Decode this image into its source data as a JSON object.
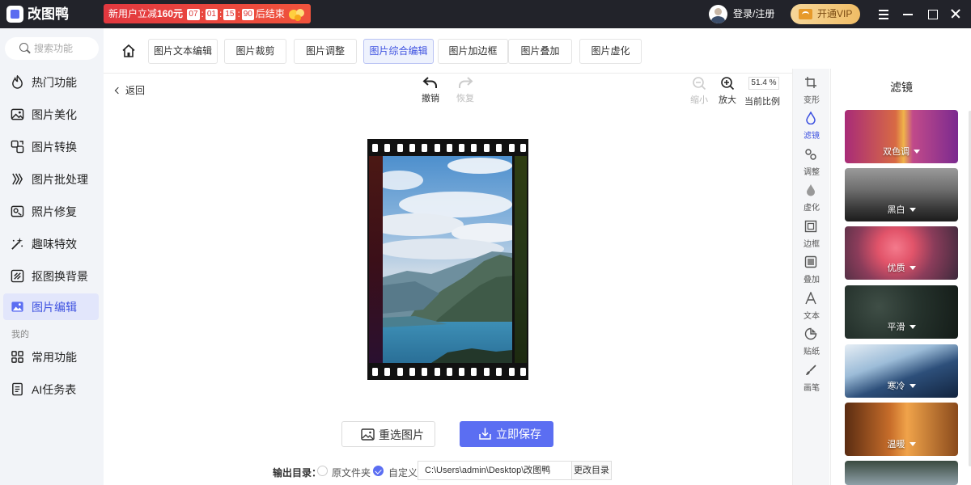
{
  "app": {
    "name": "改图鸭",
    "promo": {
      "prefix": "新用户立减",
      "amount": "160元",
      "countdown": [
        "07",
        "01",
        "15",
        "90"
      ],
      "suffix": "后结束"
    },
    "login": "登录/注册",
    "vip": "开通VIP"
  },
  "sidebar": {
    "search_placeholder": "搜索功能",
    "items": [
      {
        "label": "热门功能",
        "icon": "fire-icon"
      },
      {
        "label": "图片美化",
        "icon": "image-beautify-icon"
      },
      {
        "label": "图片转换",
        "icon": "convert-icon"
      },
      {
        "label": "图片批处理",
        "icon": "batch-icon"
      },
      {
        "label": "照片修复",
        "icon": "repair-icon"
      },
      {
        "label": "趣味特效",
        "icon": "magic-wand-icon"
      },
      {
        "label": "抠图换背景",
        "icon": "cutout-icon"
      },
      {
        "label": "图片编辑",
        "icon": "image-edit-icon",
        "active": true
      }
    ],
    "section_mine": "我的",
    "mine_items": [
      {
        "label": "常用功能",
        "icon": "grid-icon"
      },
      {
        "label": "AI任务表",
        "icon": "document-icon"
      }
    ]
  },
  "tabs": [
    "图片文本编辑",
    "图片裁剪",
    "图片调整",
    "图片综合编辑",
    "图片加边框",
    "图片叠加",
    "图片虚化"
  ],
  "active_tab": "图片综合编辑",
  "toolbar": {
    "back": "返回",
    "undo": "撤销",
    "redo": "恢复",
    "zoom_out": "缩小",
    "zoom_in": "放大",
    "zoom_value": "51.4 %",
    "zoom_label": "当前比例"
  },
  "actions": {
    "reselect": "重选图片",
    "save": "立即保存"
  },
  "output": {
    "label": "输出目录：",
    "option_original": "原文件夹",
    "option_custom": "自定义",
    "path": "C:\\Users\\admin\\Desktop\\改图鸭",
    "change": "更改目录"
  },
  "tools": [
    {
      "label": "变形",
      "icon": "crop-icon"
    },
    {
      "label": "滤镜",
      "icon": "filter-drop-icon",
      "active": true
    },
    {
      "label": "调整",
      "icon": "adjust-icon"
    },
    {
      "label": "虚化",
      "icon": "blur-drop-icon"
    },
    {
      "label": "边框",
      "icon": "frame-icon"
    },
    {
      "label": "叠加",
      "icon": "overlay-icon"
    },
    {
      "label": "文本",
      "icon": "text-icon"
    },
    {
      "label": "贴纸",
      "icon": "sticker-icon"
    },
    {
      "label": "画笔",
      "icon": "brush-icon"
    }
  ],
  "filters": {
    "title": "滤镜",
    "items": [
      "双色调",
      "黑白",
      "优质",
      "平滑",
      "寒冷",
      "温暖"
    ]
  },
  "colors": {
    "accent": "#5b6ef2",
    "titlebar": "#22232a",
    "sidebar_bg": "#f2f4f8"
  }
}
